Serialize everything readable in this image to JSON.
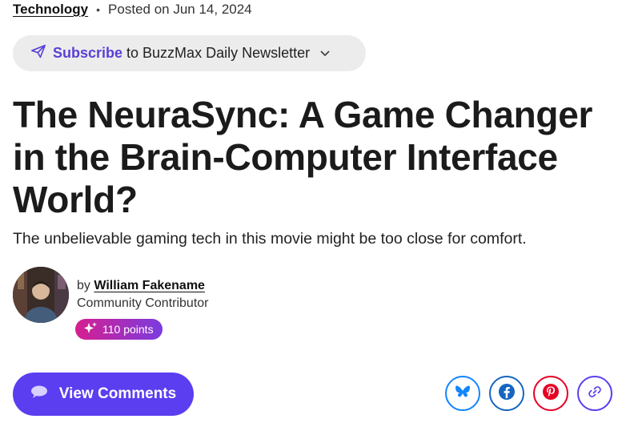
{
  "meta": {
    "category": "Technology",
    "separator": "•",
    "posted": "Posted on Jun 14, 2024"
  },
  "subscribe": {
    "action": "Subscribe",
    "text": "to BuzzMax Daily Newsletter"
  },
  "article": {
    "title": "The NeuraSync: A Game Changer in the Brain-Computer Interface World?",
    "subtitle": "The unbelievable gaming tech in this movie might be too close for comfort."
  },
  "author": {
    "by": "by",
    "name": "William Fakename",
    "role": "Community Contributor",
    "points": "110 points"
  },
  "actions": {
    "comments_label": "View Comments"
  },
  "share": {
    "icons": [
      "bluesky-icon",
      "facebook-icon",
      "pinterest-icon",
      "link-icon"
    ]
  },
  "colors": {
    "accent": "#5a3ef0",
    "bluesky": "#1185fe",
    "facebook": "#1565c0",
    "pinterest": "#e60023"
  }
}
